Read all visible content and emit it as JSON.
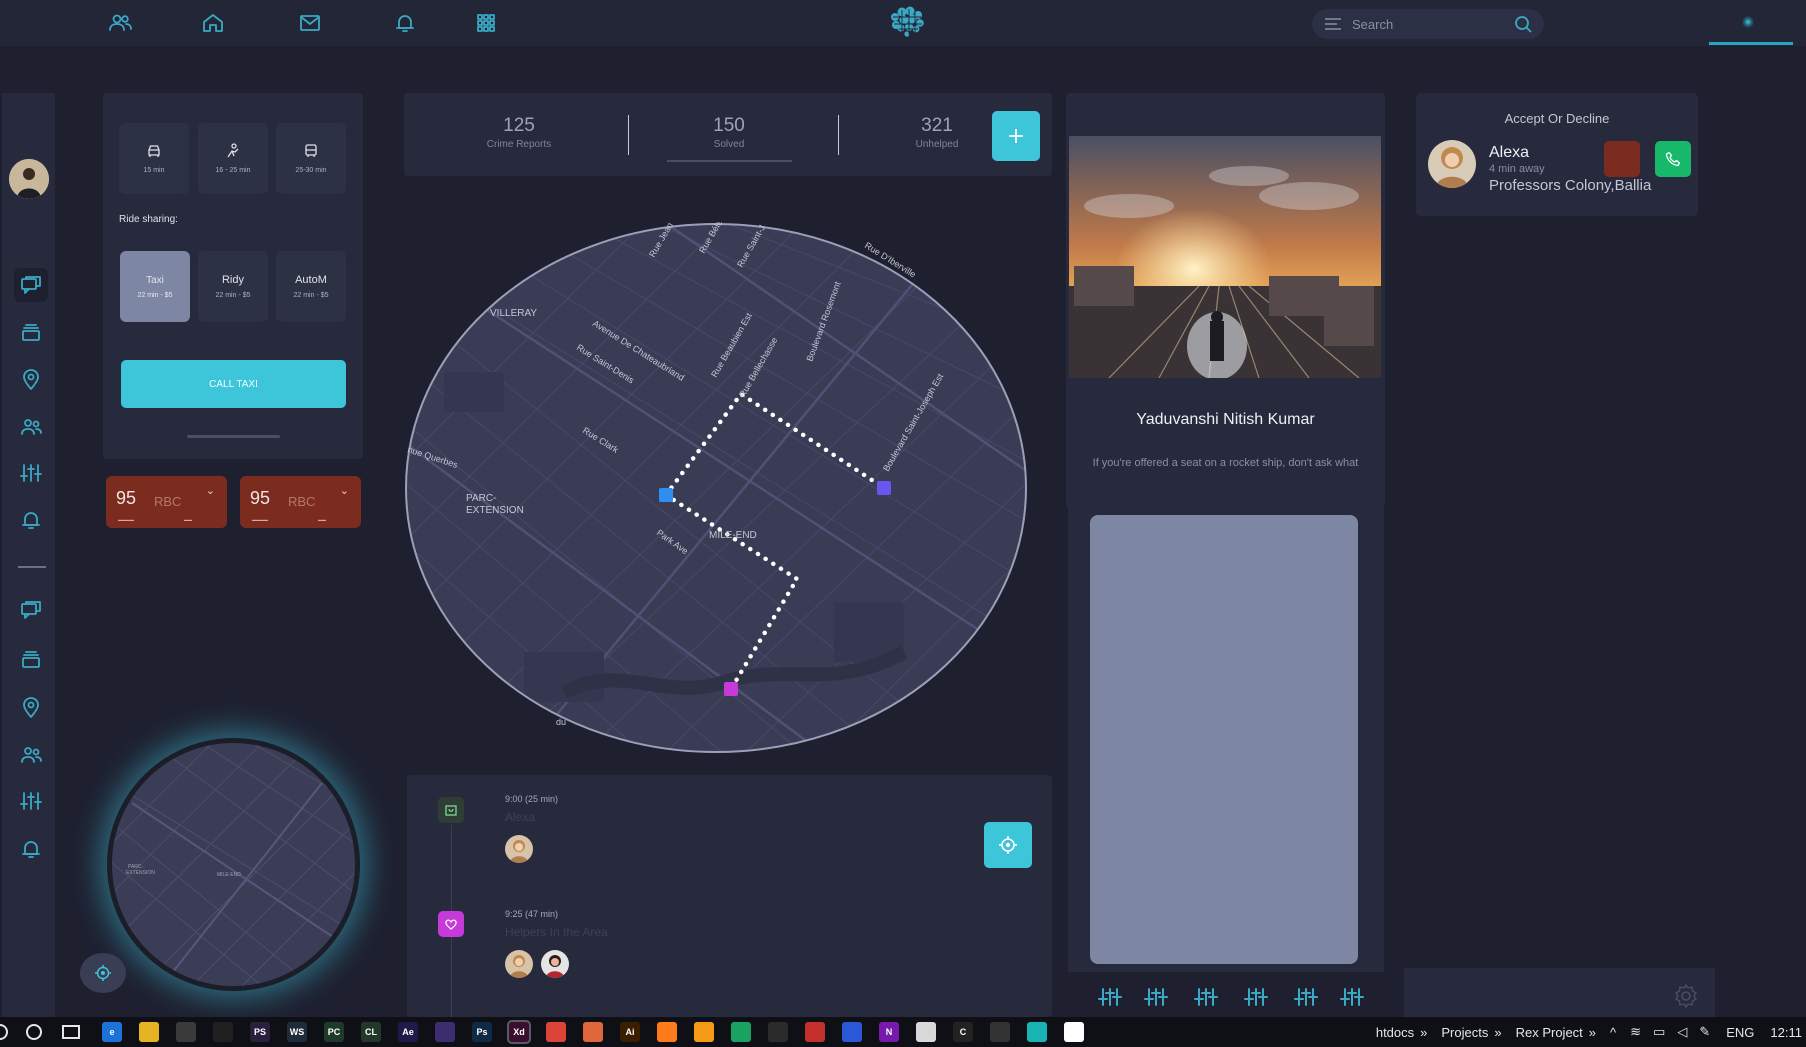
{
  "search": {
    "placeholder": "Search"
  },
  "ride": {
    "times": [
      {
        "icon": "car-icon",
        "label": "15 min"
      },
      {
        "icon": "hail-icon",
        "label": "16 - 25 min"
      },
      {
        "icon": "bus-icon",
        "label": "25-30 min"
      }
    ],
    "sharing_label": "Ride sharing:",
    "options": [
      {
        "name": "Taxi",
        "detail": "22 min - $5",
        "active": true
      },
      {
        "name": "Ridy",
        "detail": "22 min - $5",
        "active": false
      },
      {
        "name": "AutoM",
        "detail": "22 min - $5",
        "active": false
      }
    ],
    "call_label": "CALL TAXI"
  },
  "prices": [
    {
      "value": "95",
      "currency": "RBC"
    },
    {
      "value": "95",
      "currency": "RBC"
    }
  ],
  "stats": [
    {
      "value": "125",
      "label": "Crime Reports"
    },
    {
      "value": "150",
      "label": "Solved"
    },
    {
      "value": "321",
      "label": "Unhelped"
    }
  ],
  "map": {
    "labels": [
      "VILLERAY",
      "PARC-",
      "EXTENSION",
      "MILE-END",
      "Rue Clark",
      "Park Ave",
      "Rue Saint-Denis",
      "Avenue De Chateaubriand",
      "Rue Beaubien Est",
      "Rue Bellechasse",
      "Boulevard Rosemont",
      "Boulevard Saint-Joseph Est",
      "Rue D'Iberville",
      "nue Querbes",
      "Rue Jean",
      "Rue Bélé",
      "Rue Saint-J",
      "du"
    ]
  },
  "timeline": [
    {
      "time": "9:00 (25 min)",
      "title": "Alexa",
      "icon": "bag-icon",
      "color": "#2f3d34"
    },
    {
      "time": "9:25 (47 min)",
      "title": "Helpers In the Area",
      "icon": "heart-icon",
      "color": "#c53ad9"
    }
  ],
  "profile": {
    "name": "Yaduvanshi Nitish Kumar",
    "quote": "If you're offered a seat on a rocket ship, don't ask what"
  },
  "call": {
    "title": "Accept Or Decline",
    "name": "Alexa",
    "away": "4 min away",
    "address": "Professors Colony,Ballia"
  },
  "taskbar": {
    "apps": [
      {
        "label": "e",
        "color": "#1a73d9"
      },
      {
        "label": "",
        "color": "#e6b422"
      },
      {
        "label": "",
        "color": "#3a3a3a"
      },
      {
        "label": "",
        "color": "#202020"
      },
      {
        "label": "PS",
        "color": "#2a1f3d"
      },
      {
        "label": "WS",
        "color": "#1d2b3a"
      },
      {
        "label": "PC",
        "color": "#1e3a2a"
      },
      {
        "label": "CL",
        "color": "#22382a"
      },
      {
        "label": "Ae",
        "color": "#1f1a4a"
      },
      {
        "label": "",
        "color": "#3b2d6e"
      },
      {
        "label": "Ps",
        "color": "#0f2a44"
      },
      {
        "label": "Xd",
        "color": "#3a0f2e"
      },
      {
        "label": "",
        "color": "#db4437"
      },
      {
        "label": "",
        "color": "#e0663b"
      },
      {
        "label": "Ai",
        "color": "#3a1e00"
      },
      {
        "label": "",
        "color": "#ff7b1a"
      },
      {
        "label": "",
        "color": "#f49b1a"
      },
      {
        "label": "",
        "color": "#1aa260"
      },
      {
        "label": "",
        "color": "#2b2b2b"
      },
      {
        "label": "",
        "color": "#c4302b"
      },
      {
        "label": "",
        "color": "#2b58d9"
      },
      {
        "label": "N",
        "color": "#7719aa"
      },
      {
        "label": "",
        "color": "#d9d9d9"
      },
      {
        "label": "C",
        "color": "#222"
      },
      {
        "label": "",
        "color": "#333"
      },
      {
        "label": "",
        "color": "#1ab3b3"
      },
      {
        "label": "",
        "color": "#ffffff"
      }
    ],
    "links": [
      "htdocs",
      "Projects",
      "Rex Project"
    ],
    "lang": "ENG",
    "clock": "12:11"
  }
}
